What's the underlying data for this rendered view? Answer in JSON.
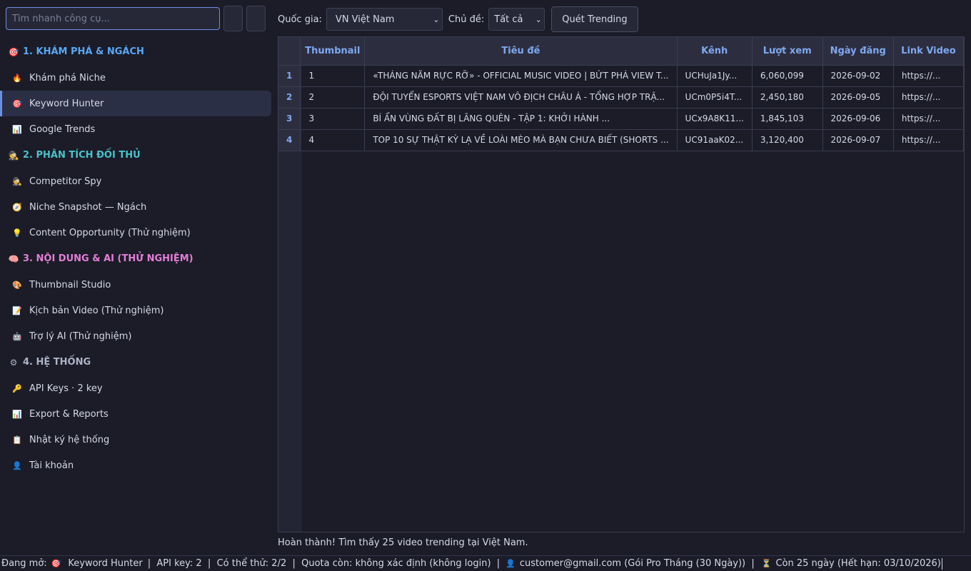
{
  "search": {
    "placeholder": "Tìm nhanh công cụ..."
  },
  "colors": {
    "section_blue": "#5aa7f5",
    "section_teal": "#49c2c9",
    "section_pink": "#e37fd6",
    "section_gray": "#aeb3c7",
    "accent": "#6d8fe0",
    "header_text": "#7fa8ef"
  },
  "sidebar": {
    "sections": [
      {
        "icon": "target-icon",
        "glyph": "🎯",
        "title": "1. KHÁM PHÁ & NGÁCH",
        "items": [
          {
            "glyph": "🔥",
            "icon": "fire-icon",
            "label": "Khám phá Niche"
          },
          {
            "glyph": "🎯",
            "icon": "target-icon",
            "label": "Keyword Hunter",
            "active": true
          },
          {
            "glyph": "📊",
            "icon": "bar-chart-icon",
            "label": "Google Trends"
          }
        ]
      },
      {
        "icon": "spy-icon",
        "glyph": "🕵",
        "title": "2. PHÂN TÍCH ĐỐI THỦ",
        "items": [
          {
            "glyph": "🕵",
            "icon": "spy-icon",
            "label": "Competitor Spy"
          },
          {
            "glyph": "🧭",
            "icon": "compass-icon",
            "label": "Niche Snapshot — Ngách"
          },
          {
            "glyph": "💡",
            "icon": "lightbulb-icon",
            "label": "Content Opportunity (Thử nghiệm)"
          }
        ]
      },
      {
        "icon": "brain-icon",
        "glyph": "🧠",
        "title": "3. NỘI DUNG & AI (THỬ NGHIỆM)",
        "items": [
          {
            "glyph": "🎨",
            "icon": "palette-icon",
            "label": "Thumbnail Studio"
          },
          {
            "glyph": "📝",
            "icon": "memo-icon",
            "label": "Kịch bản Video (Thử nghiệm)"
          },
          {
            "glyph": "🤖",
            "icon": "robot-icon",
            "label": "Trợ lý AI (Thử nghiệm)"
          }
        ]
      },
      {
        "icon": "gear-icon",
        "glyph": "⚙",
        "title": "4. HỆ THỐNG",
        "items": [
          {
            "glyph": "🔑",
            "icon": "key-icon",
            "label": "API Keys · 2 key"
          },
          {
            "glyph": "📊",
            "icon": "bar-chart-icon",
            "label": "Export & Reports"
          },
          {
            "glyph": "📋",
            "icon": "clipboard-icon",
            "label": "Nhật ký hệ thống"
          },
          {
            "glyph": "👤",
            "icon": "user-icon",
            "label": "Tài khoản"
          }
        ]
      }
    ]
  },
  "toolbar": {
    "country_label": "Quốc gia:",
    "country_value": "VN Việt Nam",
    "topic_label": "Chủ đề:",
    "topic_value": "Tất cả",
    "scan_button": "Quét Trending"
  },
  "table": {
    "columns": [
      "Thumbnail",
      "Tiêu đề",
      "Kênh",
      "Lượt xem",
      "Ngày đăng",
      "Link Video"
    ],
    "rows": [
      {
        "n": "1",
        "cells": [
          "1",
          "«THÁNG NĂM RỰC RỠ» - OFFICIAL MUSIC VIDEO | BỨT PHÁ VIEW T...",
          "UCHuJa1Jy...",
          "6,060,099",
          "2026-09-02",
          "https://..."
        ]
      },
      {
        "n": "2",
        "cells": [
          "2",
          "ĐỘI TUYỂN ESPORTS VIỆT NAM VÔ ĐỊCH CHÂU Á - TỔNG HỢP TRẬ...",
          "UCm0P5i4T...",
          "2,450,180",
          "2026-09-05",
          "https://..."
        ]
      },
      {
        "n": "3",
        "cells": [
          "3",
          "BÍ ẨN VÙNG ĐẤT BỊ LÃNG QUÊN - TẬP 1: KHỞI HÀNH ...",
          "UCx9A8K11...",
          "1,845,103",
          "2026-09-06",
          "https://..."
        ]
      },
      {
        "n": "4",
        "cells": [
          "4",
          "TOP 10 SỰ THẬT KỲ LẠ VỀ LOÀI MÈO MÀ BẠN CHƯA BIẾT (SHORTS ...",
          "UC91aaK02...",
          "3,120,400",
          "2026-09-07",
          "https://..."
        ]
      }
    ]
  },
  "status_message": "Hoàn thành! Tìm thấy 25 video trending tại Việt Nam.",
  "bottombar": {
    "open_label": "Đang mở:",
    "open_glyph": "🎯",
    "open_value": "Keyword Hunter",
    "middle": "|  API key: 2  |  Có thể thử: 2/2  |  Quota còn: không xác định (không login)  |",
    "user_glyph": "👤",
    "user": "customer@gmail.com (Gói Pro Tháng (30 Ngày))  |",
    "time_glyph": "⏳",
    "remaining": "Còn 25 ngày (Hết hạn: 03/10/2026)"
  }
}
